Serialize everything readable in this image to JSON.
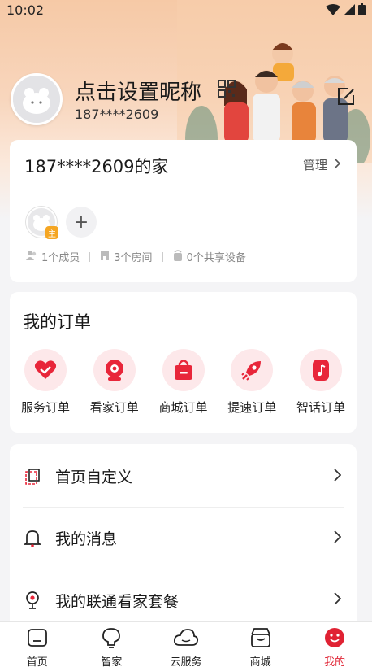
{
  "status": {
    "time": "10:02"
  },
  "profile": {
    "nickname": "点击设置昵称",
    "phone": "187****2609"
  },
  "home": {
    "title": "187****2609的家",
    "manage_label": "管理",
    "stats": [
      "1个成员",
      "3个房间",
      "0个共享设备"
    ]
  },
  "orders": {
    "title": "我的订单",
    "items": [
      {
        "label": "服务订单",
        "icon": "heart-service-icon"
      },
      {
        "label": "看家订单",
        "icon": "camera-icon"
      },
      {
        "label": "商城订单",
        "icon": "shopping-bag-icon"
      },
      {
        "label": "提速订单",
        "icon": "rocket-icon"
      },
      {
        "label": "智话订单",
        "icon": "music-note-icon"
      }
    ]
  },
  "menu": [
    {
      "label": "首页自定义",
      "icon": "customize-icon"
    },
    {
      "label": "我的消息",
      "icon": "bell-icon"
    },
    {
      "label": "我的联通看家套餐",
      "icon": "location-pin-icon"
    }
  ],
  "tabs": [
    {
      "label": "首页",
      "icon": "home-icon"
    },
    {
      "label": "智家",
      "icon": "bulb-icon"
    },
    {
      "label": "云服务",
      "icon": "cloud-icon"
    },
    {
      "label": "商城",
      "icon": "store-icon"
    },
    {
      "label": "我的",
      "icon": "profile-icon"
    }
  ],
  "colors": {
    "accent": "#e02233",
    "accent_light": "#fde8ea",
    "header_gradient": "#f6c9a6"
  }
}
